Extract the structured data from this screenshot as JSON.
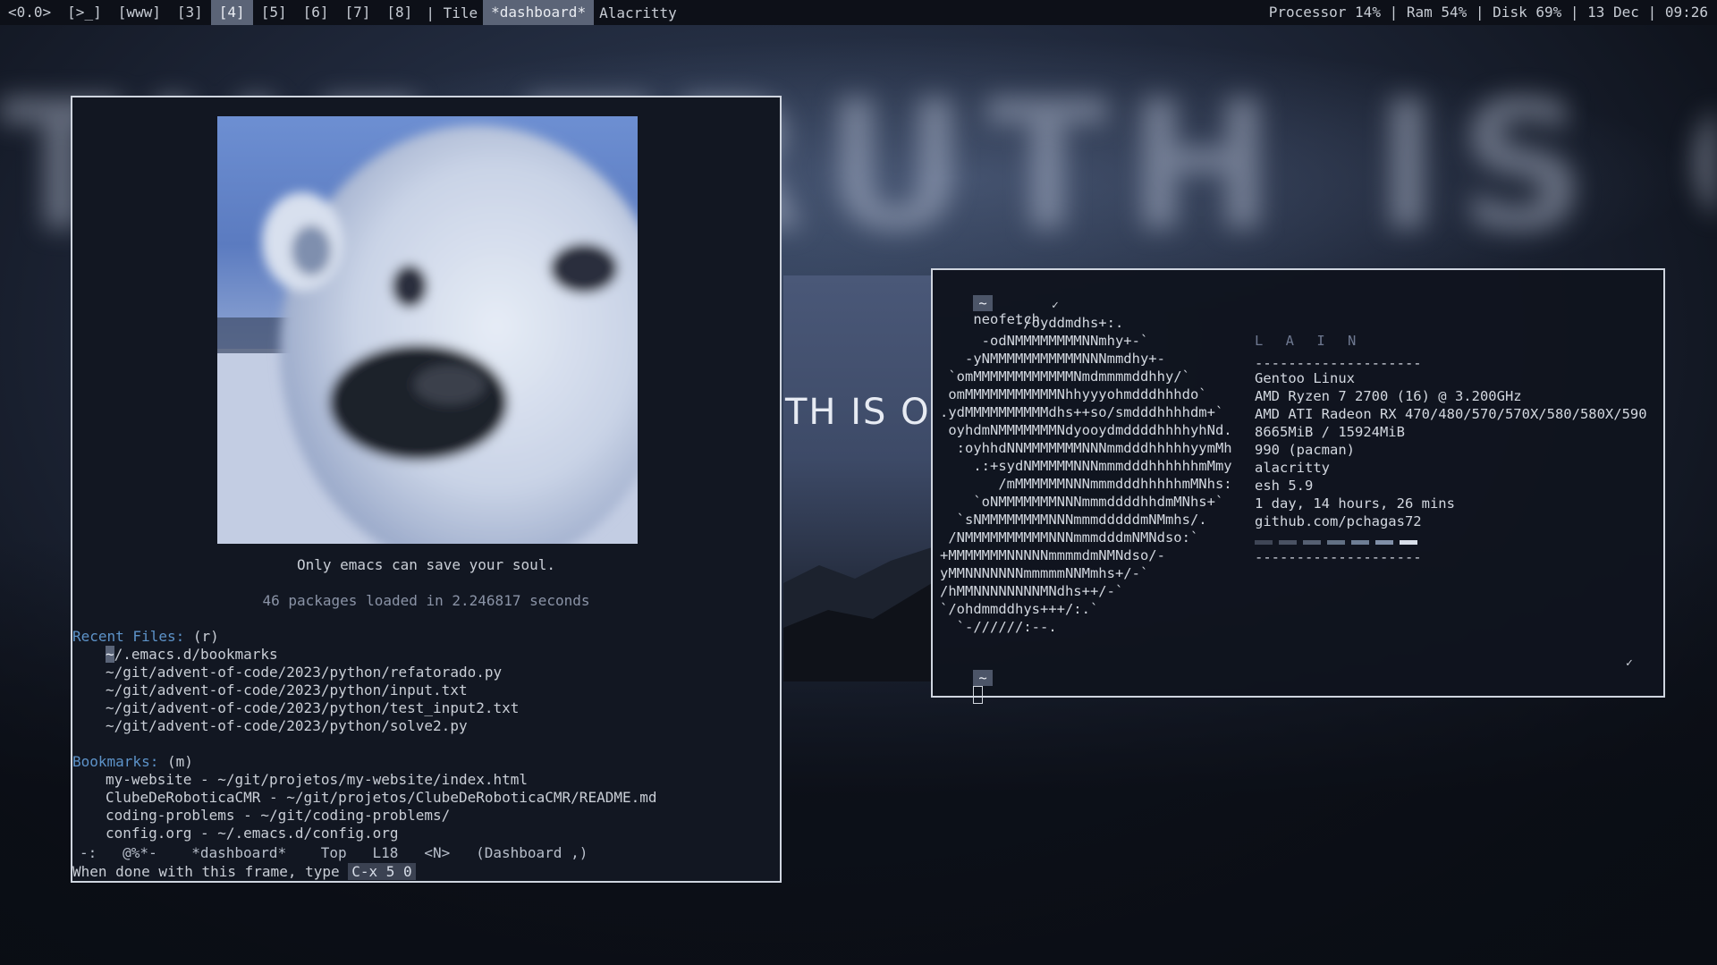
{
  "wallpaper": {
    "text": "THE TRUTH IS OUT THERE"
  },
  "topbar": {
    "workspaces": [
      "<0.0>",
      "[>_]",
      "[www]",
      "[3]",
      "[4]",
      "[5]",
      "[6]",
      "[7]",
      "[8]"
    ],
    "active_workspace_index": 4,
    "layout": "| Tile",
    "window_titles": [
      "*dashboard*",
      "Alacritty"
    ],
    "status": "Processor 14% | Ram 54% | Disk 69% | 13 Dec | 09:26"
  },
  "emacs": {
    "banner": "Only emacs can save your soul.",
    "packages_line": "46 packages loaded in 2.246817 seconds",
    "recent_files_heading": "Recent Files:",
    "recent_files_key": "(r)",
    "recent_files": [
      "~/.emacs.d/bookmarks",
      "~/git/advent-of-code/2023/python/refatorado.py",
      "~/git/advent-of-code/2023/python/input.txt",
      "~/git/advent-of-code/2023/python/test_input2.txt",
      "~/git/advent-of-code/2023/python/solve2.py"
    ],
    "bookmarks_heading": "Bookmarks:",
    "bookmarks_key": "(m)",
    "bookmarks": [
      "my-website - ~/git/projetos/my-website/index.html",
      "ClubeDeRoboticaCMR - ~/git/projetos/ClubeDeRoboticaCMR/README.md",
      "coding-problems - ~/git/coding-problems/",
      "config.org - ~/.emacs.d/config.org"
    ],
    "modeline": "-:   @%*-    *dashboard*    Top   L18   <N>   (Dashboard ,)",
    "minibuffer_text": "When done with this frame, type ",
    "minibuffer_keys": "C-x 5 0"
  },
  "photo_window": {
    "text": "TH IS OU"
  },
  "terminal": {
    "prompt_symbol": "~",
    "command": "neofetch",
    "check_mark": "✓",
    "ascii_art": [
      "         -/oyddmdhs+:.",
      "     -odNMMMMMMMMNNmhy+-`",
      "   -yNMMMMMMMMMMMNNNmmdhy+-",
      " `omMMMMMMMMMMMMNmdmmmmddhhy/`",
      " omMMMMMMMMMMMNhhyyyohmdddhhhdo`",
      ".ydMMMMMMMMMMdhs++so/smdddhhhhdm+`",
      " oyhdmNMMMMMMMNdyooydmddddhhhhyhNd.",
      "  :oyhhdNNMMMMMMMNNNmmdddhhhhhyymMh",
      "    .:+sydNMMMMMNNNmmmdddhhhhhhmMmy",
      "       /mMMMMMMNNNmmmdddhhhhhmMNhs:",
      "    `oNMMMMMMMNNNmmmddddhhdmMNhs+`",
      "  `sNMMMMMMMMNNNmmmdddddmNMmhs/.",
      " /NMMMMMMMMMMNNNmmmdddmNMNdso:`",
      "+MMMMMMMNNNNNmmmmdmNMNdso/-",
      "yMMNNNNNNNmmmmmNNMmhs+/-`",
      "/hMMNNNNNNNNMNdhs++/-`",
      "`/ohdmmddhys+++/:.`",
      "  `-//////:--."
    ],
    "info": {
      "header": "L A I N",
      "separator": "--------------------",
      "lines": [
        "Gentoo Linux",
        "AMD Ryzen 7 2700 (16) @ 3.200GHz",
        "AMD ATI Radeon RX 470/480/570/570X/580/580X/590",
        "8665MiB / 15924MiB",
        "990 (pacman)",
        "alacritty",
        "esh 5.9",
        "1 day, 14 hours, 26 mins",
        "github.com/pchagas72"
      ],
      "swatch_colors": [
        "#3f4656",
        "#4a5263",
        "#566072",
        "#627084",
        "#6e7e95",
        "#8190a8",
        "#d8dee9"
      ]
    }
  }
}
